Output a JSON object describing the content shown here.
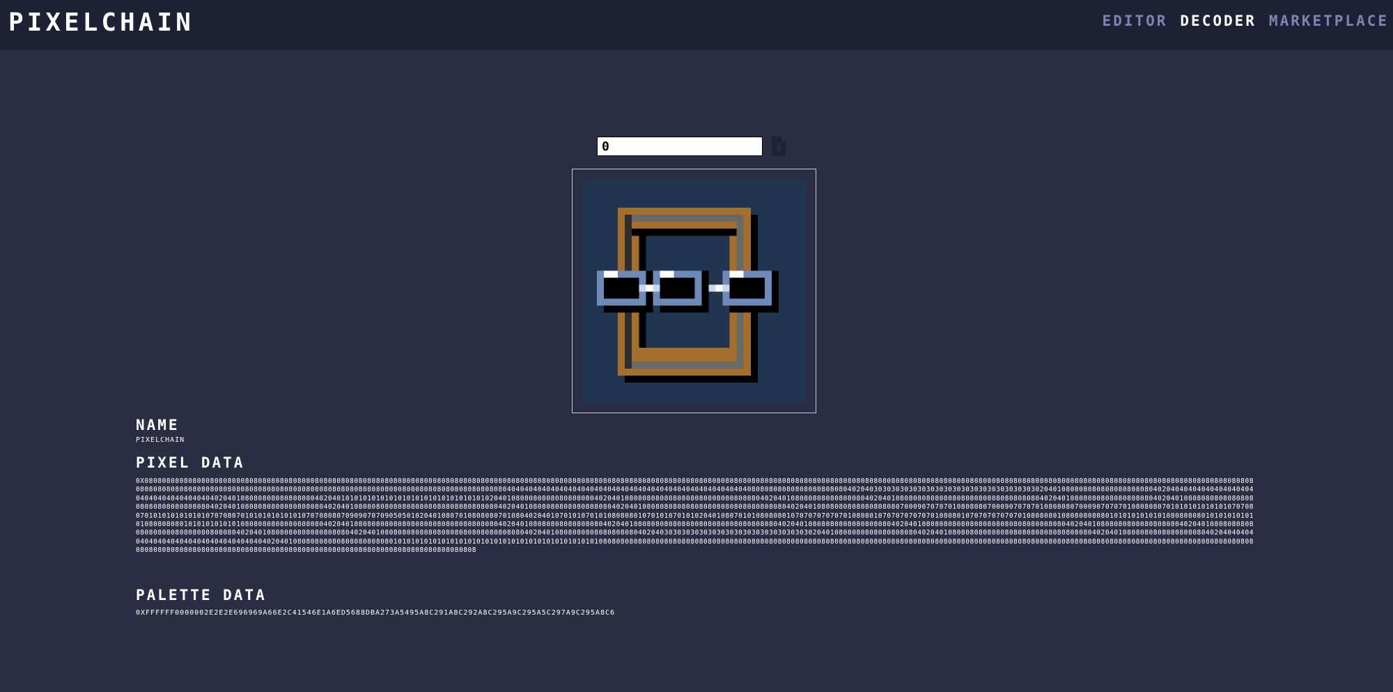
{
  "header": {
    "logo": "PIXELCHAIN",
    "nav": [
      "EDITOR",
      "DECODER",
      "MARKETPLACE"
    ],
    "active_nav": "DECODER"
  },
  "decoder": {
    "token_id_value": "0",
    "upload_icon": "upload-icon"
  },
  "details": {
    "name_heading": "NAME",
    "name_value": "PIXELCHAIN",
    "pixel_heading": "PIXEL DATA",
    "pixel_value": "0X080808080808080808080808080808080808080808080808080808080808080808080808080808080808080808080808080808080808080808080808080808080808080808080808080808080808080808080808080808080808080808080808080808080808080808080808080808080808080808080808080808080808080808080808080808080808080808080808080808080808080808080808080808080808080808080808080404040404040404040404040404040404040404040404040404040408080808080808080808080402040303030303030303030303030303030303030302040108080808080808080808040204040404040404040404040404040404040404020401080808080808080804020401010101010101010101010101010101010204010808080808080808080402040108080808080808080808080808080804020401080808080808080804020401080808080808080808080808080808080402040108080808080808080804020401080808080808080808080808080808080402040108080808080808080804020401080808080808080808080808080808080402040108080808080808080804020401080808080808080808080808080808080402040108080808080808080807000907070701080808070009070707010808080700090707070108080807010101010101010707080701010101010101070708070101010101010107070808070909070709050501020401080701080808070108040204010701010701010808080107010107010102040108070101080808010707070707070108080107070707070701080801070707070707010808080108080808080101010101010108080808010101010101010808080801010101010101080808080808080808040204010808080808080808080808080808080804020401080808080808080804020401080808080808080808080808080808080402040108080808080808080804020401080808080808080808080808080808080402040108080808080808080804020401080808080808080808080808080808080402040108080808080808080804020401080808080808080808080808080808080402040108080808080808080804020403030303030303030303030303030303030204010808080808080808080402040108080808080808080808080808080808040204010808080808080808080402040404040404040404040404040404040404040204010808080808080808080808010101010101010101010101010101010101010101010101080808080808080808080808080808080808080808080808080808080808080808080808080808080808080808080808080808080808080808080808080808080808080808080808080808080808080808080808080808080808080808080808080808080808080808080808080808080808",
    "palette_heading": "PALETTE DATA",
    "palette_value": "0XFFFFFF0000002E2E2E696969A66E2C41546E1A6ED5688DBA273A5495A8C291A8C292A8C295A9C295A5C297A9C295A8C6"
  },
  "sprite_colors": {
    "background": "#223550",
    "wood": "#a66e2c",
    "wood_inner": "#696969",
    "dark": "#2e2e2e",
    "black": "#000000",
    "chain": "#6e8ab8",
    "chain_light": "#c9d6ee",
    "white": "#ffffff"
  }
}
